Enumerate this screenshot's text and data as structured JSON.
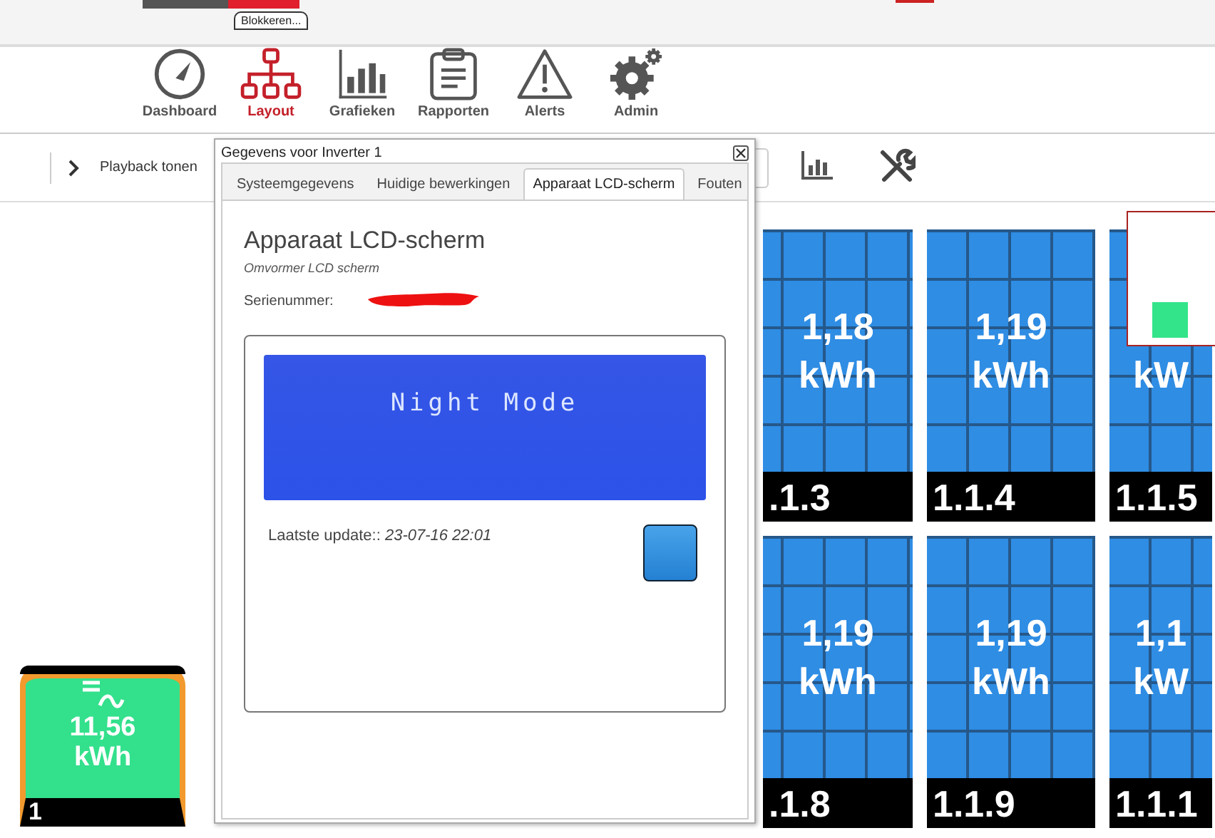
{
  "header": {
    "tooltip": "Blokkeren..."
  },
  "nav": [
    {
      "label": "Dashboard",
      "selected": false
    },
    {
      "label": "Layout",
      "selected": true
    },
    {
      "label": "Grafieken",
      "selected": false
    },
    {
      "label": "Rapporten",
      "selected": false
    },
    {
      "label": "Alerts",
      "selected": false
    },
    {
      "label": "Admin",
      "selected": false
    }
  ],
  "toolbar": {
    "playback_label": "Playback tonen"
  },
  "panels": [
    {
      "energy": "1,18",
      "unit": "kWh",
      "number": ".1.3"
    },
    {
      "energy": "1,19",
      "unit": "kWh",
      "number": "1.1.4"
    },
    {
      "unit": "kW",
      "number": "1.1.5"
    },
    {
      "energy": "1,19",
      "unit": "kWh",
      "number": ".1.8"
    },
    {
      "energy": "1,19",
      "unit": "kWh",
      "number": "1.1.9"
    },
    {
      "energy": "1,1",
      "unit": "kW",
      "number": "1.1.1"
    }
  ],
  "inverter": {
    "value": "11,56",
    "unit": "kWh",
    "label": "1"
  },
  "dialog": {
    "title": "Gegevens voor Inverter 1",
    "tabs": [
      {
        "label": "Systeemgegevens",
        "selected": false
      },
      {
        "label": "Huidige bewerkingen",
        "selected": false
      },
      {
        "label": "Apparaat LCD-scherm",
        "selected": true
      },
      {
        "label": "Fouten",
        "selected": false
      }
    ],
    "heading": "Apparaat LCD-scherm",
    "subtitle": "Omvormer LCD scherm",
    "serial_label": "Serienummer:",
    "lcd_text": "Night Mode",
    "update_label": "Laatste update::",
    "update_time": "23-07-16 22:01"
  }
}
